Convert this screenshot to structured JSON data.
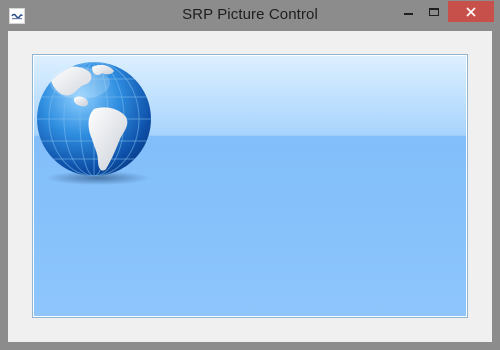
{
  "window": {
    "title": "SRP Picture Control",
    "icon": "app-icon",
    "controls": [
      "minimize-icon",
      "maximize-icon",
      "close-icon"
    ]
  },
  "picture_control": {
    "image": "globe-icon"
  },
  "colors": {
    "titlebar": "#8c8c8c",
    "close_button": "#c7504a",
    "client_background": "#f0f0f0",
    "picture_top": "#dcefff",
    "picture_bottom": "#8ec6fc"
  }
}
